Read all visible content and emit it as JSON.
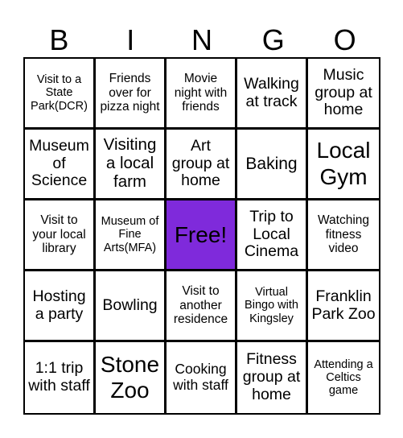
{
  "card": {
    "header_letters": [
      "B",
      "I",
      "N",
      "G",
      "O"
    ],
    "free_color": "#7f2adb",
    "cells": [
      [
        "Visit to a State Park(DCR)",
        "Friends over for pizza night",
        "Movie night with friends",
        "Walking at track",
        "Music group at home"
      ],
      [
        "Museum of Science",
        "Visiting a local farm",
        "Art group at home",
        "Baking",
        "Local Gym"
      ],
      [
        "Visit to your local library",
        "Museum of Fine Arts(MFA)",
        "Free!",
        "Trip to Local Cinema",
        "Watching fitness video"
      ],
      [
        "Hosting a party",
        "Bowling",
        "Visit to another residence",
        "Virtual Bingo with Kingsley",
        "Franklin Park Zoo"
      ],
      [
        "1:1 trip with staff",
        "Stone Zoo",
        "Cooking with staff",
        "Fitness group at home",
        "Attending a Celtics game"
      ]
    ]
  }
}
